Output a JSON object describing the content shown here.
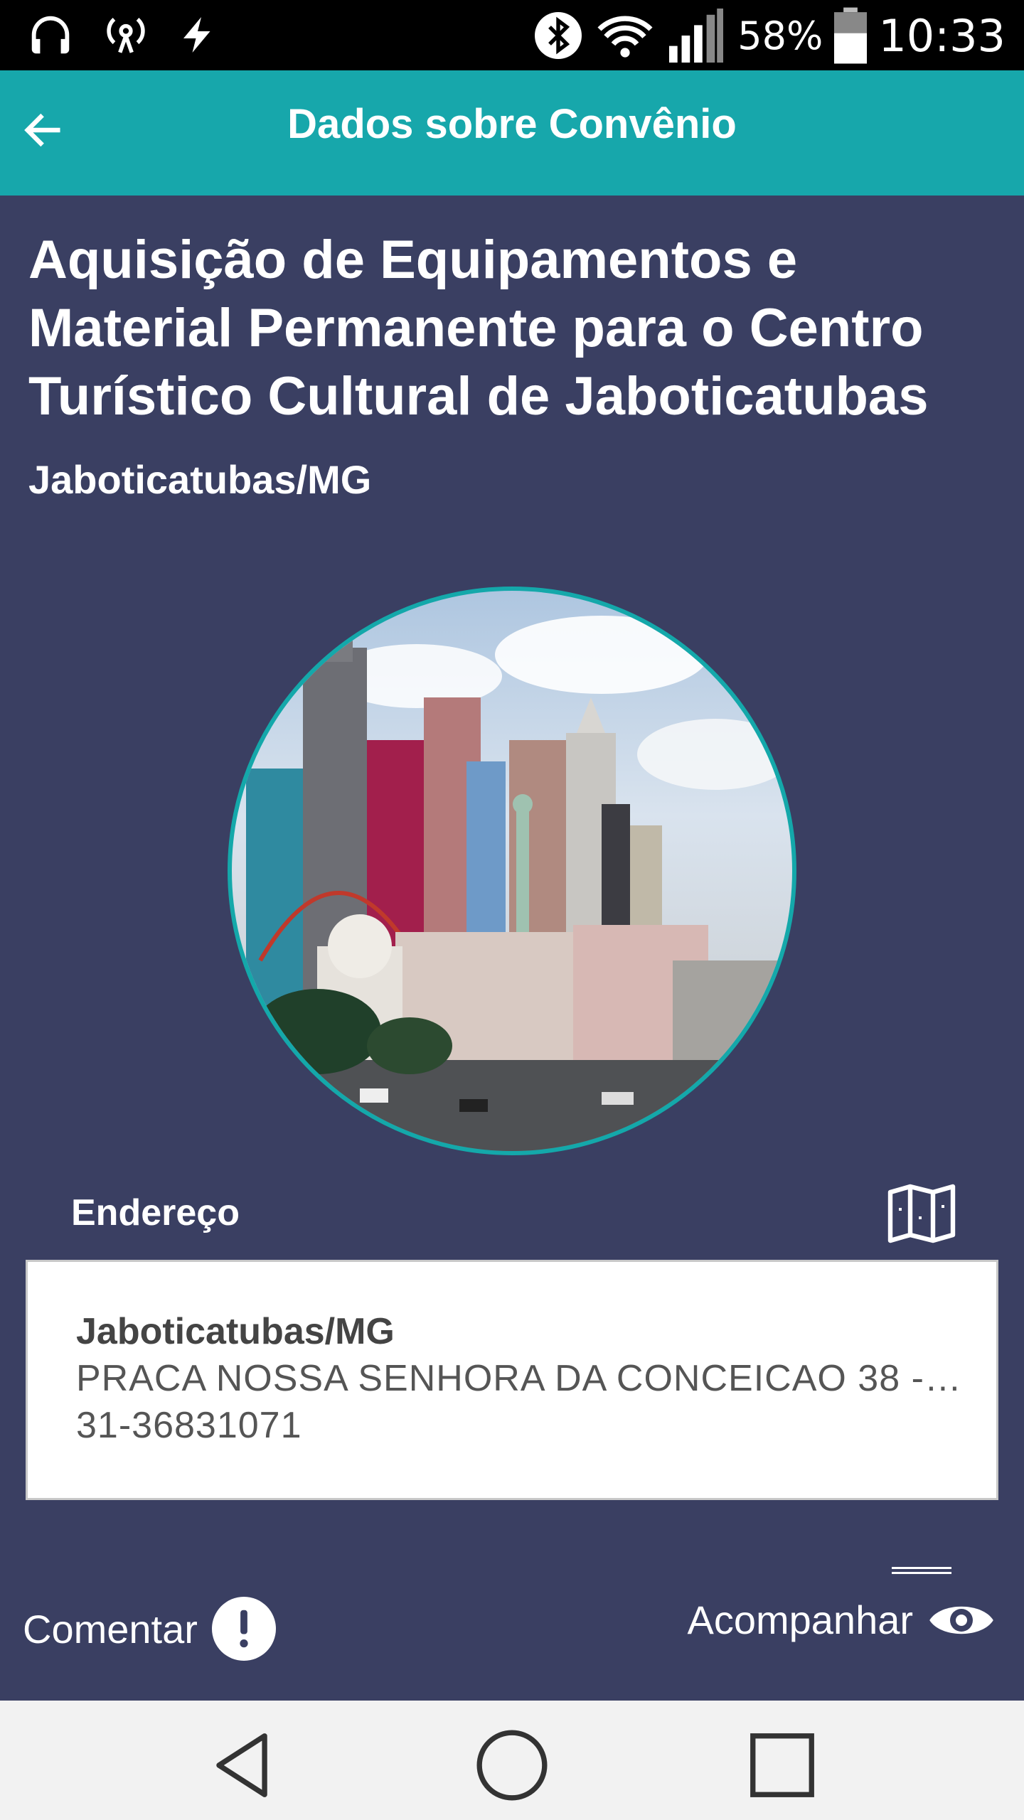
{
  "status_bar": {
    "icons_left": [
      "headphones-icon",
      "hotspot-icon",
      "charging-icon"
    ],
    "icons_right": [
      "bluetooth-icon",
      "wifi-icon",
      "signal-icon"
    ],
    "battery": "58%",
    "time": "10:33"
  },
  "app_bar": {
    "title": "Dados sobre Convênio",
    "back_icon": "arrow-left-icon"
  },
  "header": {
    "title": "Aquisição de Equipamentos e Material Permanente para o Centro Turístico Cultural de Jaboticatubas",
    "city": "Jaboticatubas/MG"
  },
  "address": {
    "label": "Endereço",
    "city": "Jaboticatubas/MG",
    "street": "PRACA NOSSA SENHORA DA CONCEICAO 38 - 3…",
    "phone": "31-36831071"
  },
  "actions": {
    "comment_label": "Comentar",
    "follow_label": "Acompanhar"
  },
  "colors": {
    "accent": "#17a7ab",
    "background": "#3a3f62",
    "card": "#ffffff"
  }
}
